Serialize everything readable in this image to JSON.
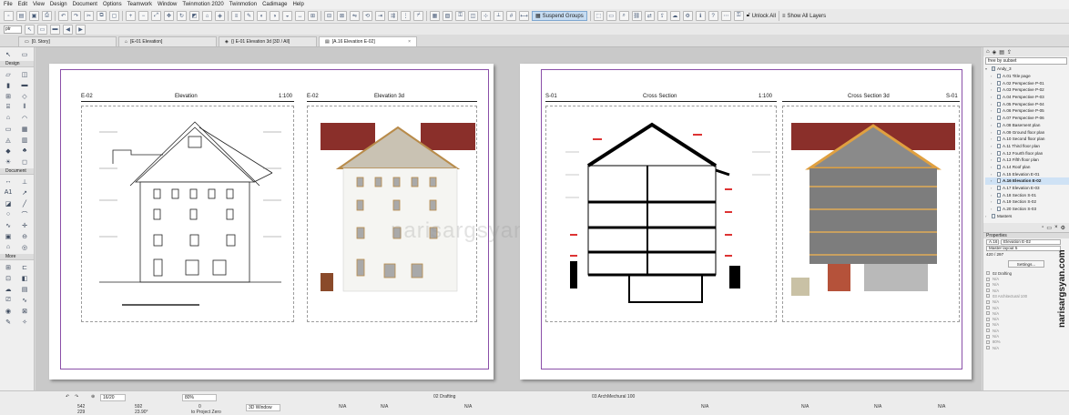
{
  "menu": [
    "File",
    "Edit",
    "View",
    "Design",
    "Document",
    "Options",
    "Teamwork",
    "Window",
    "Twinmotion 2020",
    "Twinmotion",
    "Cadimage",
    "Help"
  ],
  "toolbar": {
    "suspend_groups": "Suspend Groups",
    "unlock_all": "Unlock All",
    "show_all_layers": "Show All Layers"
  },
  "toolbar2": {
    "combo": "ptr"
  },
  "tabs": [
    {
      "label": "[0. Story]",
      "active": false
    },
    {
      "label": "[E-01 Elevation]",
      "active": false
    },
    {
      "label": "{} E-01 Elevation 3d [3D / All]",
      "active": false
    },
    {
      "label": "[A.16 Elevation E-02]",
      "active": true
    }
  ],
  "toolbox": {
    "design": "Design",
    "document": "Document",
    "more": "More",
    "text_tool": "A1"
  },
  "sheets": {
    "left": {
      "drawing1": {
        "id": "E-02",
        "name": "Elevation",
        "scale": "1:100"
      },
      "drawing2": {
        "id": "E-02",
        "name": "Elevation 3d"
      }
    },
    "right": {
      "drawing1": {
        "id": "S-01",
        "name": "Cross Section",
        "scale": "1:100"
      },
      "drawing2": {
        "id": "S-01",
        "name": "Cross Section 3d"
      }
    }
  },
  "watermark": "narisargsyan.com",
  "navigator": {
    "combo": "free by subset",
    "root": "Andy_3",
    "items": [
      "A.01 Title page",
      "A.02 Perspective P-01",
      "A.03 Perspective P-02",
      "A.04 Perspective P-03",
      "A.05 Perspective P-04",
      "A.06 Perspective P-05",
      "A.07 Perspective P-06",
      "A.08 Basement plan",
      "A.09 Ground floor plan",
      "A.10 Second floor plan",
      "A.11 Third floor plan",
      "A.12 Fourth floor plan",
      "A.13 Fifth floor plan",
      "A.14 Roof plan",
      "A.15 Elevation E-01",
      "A.16 Elevation E-02",
      "A.17 Elevation E-03",
      "A.18 Section S-01",
      "A.19 Section S-02",
      "A.20 Section S-03"
    ],
    "selected_index": 15,
    "masters": "Masters",
    "properties_title": "Properties",
    "prop_id": "A.16",
    "prop_name": "Elevation E-02",
    "prop_master": "Master layout 5",
    "prop_size": "420 / 297",
    "settings": "Settings...",
    "layer_header": "02 Drafting",
    "layers": [
      "N/A",
      "N/A",
      "N/A",
      "03 Architectural 100",
      "N/A",
      "N/A",
      "N/A",
      "N/A",
      "N/A",
      "N/A",
      "N/A",
      "80%",
      "N/A"
    ]
  },
  "site_text": "narisargsyan.com",
  "status": {
    "page": "16/20",
    "zoom": "80%",
    "coord_x": "542",
    "coord_y": "229",
    "coord_r": "592",
    "coord_a": "23.90°",
    "coord_z": "0",
    "project_zero": "to Project Zero",
    "window3d": "3D Window",
    "na": "N/A",
    "layer": "02 Drafting",
    "layer2": "03 ArchMechural 100"
  }
}
